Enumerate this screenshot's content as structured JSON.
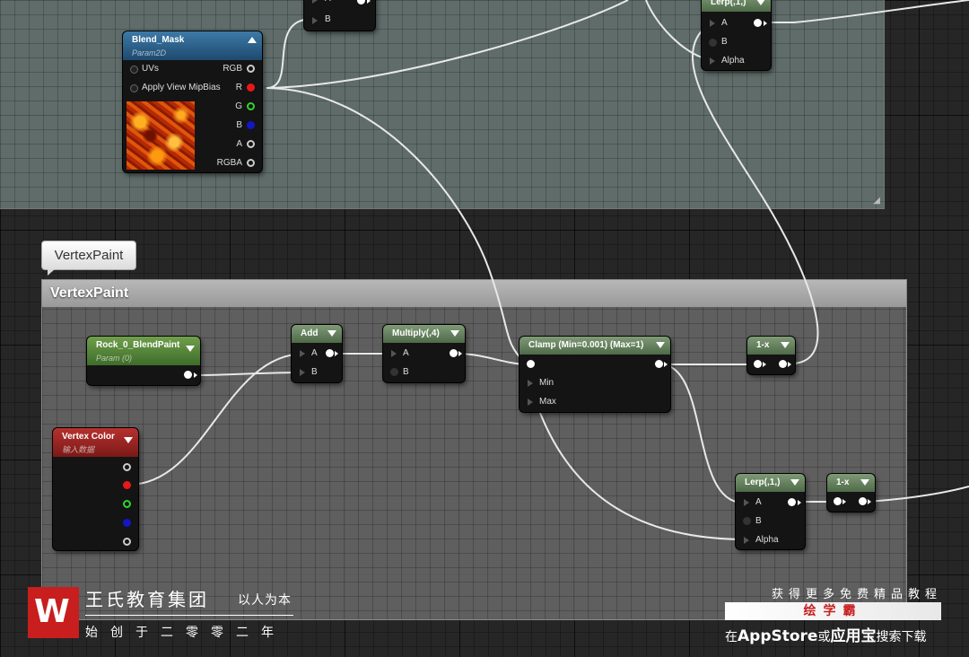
{
  "comments": {
    "vertex_paint": {
      "bubble_label": "VertexPaint",
      "header_label": "VertexPaint"
    }
  },
  "nodes": {
    "top_partial": {
      "pin_a": "A",
      "pin_b": "B"
    },
    "lerp_top": {
      "title": "Lerp(,1,)",
      "pin_a": "A",
      "pin_b": "B",
      "pin_alpha": "Alpha"
    },
    "blend_mask": {
      "title": "Blend_Mask",
      "subtitle": "Param2D",
      "inputs": [
        "UVs",
        "Apply View MipBias"
      ],
      "outputs": [
        "RGB",
        "R",
        "G",
        "B",
        "A",
        "RGBA"
      ]
    },
    "rock_blend": {
      "title": "Rock_0_BlendPaint",
      "subtitle": "Param (0)"
    },
    "add": {
      "title": "Add",
      "pin_a": "A",
      "pin_b": "B"
    },
    "multiply": {
      "title": "Multiply(,4)",
      "pin_a": "A",
      "pin_b": "B"
    },
    "clamp": {
      "title": "Clamp (Min=0.001) (Max=1)",
      "pin_min": "Min",
      "pin_max": "Max"
    },
    "one_minus_1": {
      "title": "1-x"
    },
    "vertex_color": {
      "title": "Vertex Color",
      "subtitle": "输入数据"
    },
    "lerp_bottom": {
      "title": "Lerp(,1,)",
      "pin_a": "A",
      "pin_b": "B",
      "pin_alpha": "Alpha"
    },
    "one_minus_2": {
      "title": "1-x"
    }
  },
  "colors": {
    "pin_red": "#e81818",
    "pin_green": "#2ed52e",
    "pin_blue": "#1515c8",
    "param2d_header": "#2f6591",
    "param_header": "#5a8a3c",
    "vertex_color_header": "#a02623",
    "brand_red": "#c81e1e"
  },
  "watermark": {
    "company_name": "王氏教育集团",
    "slogan": "以人为本",
    "since": "始创于二零零二年",
    "promo_line1": "获得更多免费精品教程",
    "brand": "绘学霸",
    "promo_pre": "在",
    "promo_app1": "AppStore",
    "promo_mid": "或",
    "promo_app2": "应用宝",
    "promo_post": "搜索下载"
  }
}
